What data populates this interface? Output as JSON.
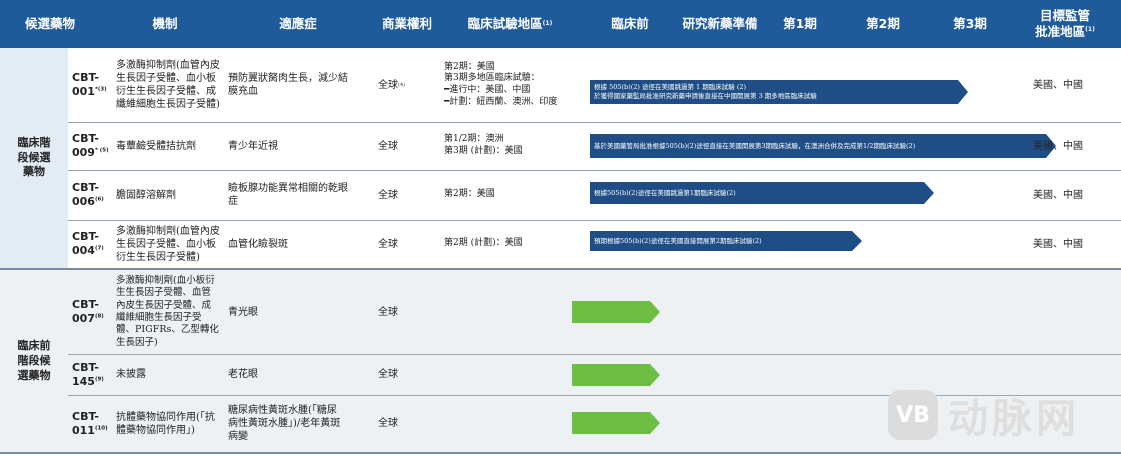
{
  "header": {
    "candidate": "候選藥物",
    "mechanism": "機制",
    "indication": "適應症",
    "rights": "商業權利",
    "region": "臨床試驗地區",
    "region_note": "(1)",
    "preclinical": "臨床前",
    "ind": "研究新藥準備",
    "phase1": "第1期",
    "phase2": "第2期",
    "phase3": "第3期",
    "target": "目標監管批准地區",
    "target_note": "(1)"
  },
  "categories": {
    "clinical": "臨床階段候選藥物",
    "preclinical": "臨床前階段候選藥物"
  },
  "rows": [
    {
      "code": "CBT-001",
      "note": "*(3)",
      "mechanism": "多激酶抑制劑(血管內皮生長因子受體、血小板衍生生長因子受體、成纖維細胞生長因子受體)",
      "indication": "預防翼狀胬肉生長，減少結膜充血",
      "rights": "全球",
      "rights_note": "(4)",
      "region": "第2期：美國\n第3期多地區臨床試驗：\n━進行中：美國、中國\n━計劃：紐西蘭、澳洲、印度",
      "arrow": "根據 505(b)(2) 途徑在美國跳過第 1 期臨床試驗 (2)\n於獲得國家藥監局批准研究新藥申請後直接在中國開展第 3 期多地區臨床試驗",
      "target": "美國、中國"
    },
    {
      "code": "CBT-009",
      "note": "* (5)",
      "mechanism": "毒蕈鹼受體拮抗劑",
      "indication": "青少年近視",
      "rights": "全球",
      "rights_note": "",
      "region": "第1/2期：澳洲\n第3期 (計劃)：美國",
      "arrow": "基於美國藥管局批准根據505(b)(2)途徑直接在美國開展第3期臨床試驗，在澳洲合併及完成第1/2期臨床試驗(2)",
      "target": "美國、中國"
    },
    {
      "code": "CBT-006",
      "note": "(6)",
      "mechanism": "膽固醇溶解劑",
      "indication": "瞼板腺功能異常相關的乾眼症",
      "rights": "全球",
      "rights_note": "",
      "region": "第2期：美國",
      "arrow": "根據505(b)(2)途徑在美國跳過第1期臨床試驗(2)",
      "target": "美國、中國"
    },
    {
      "code": "CBT-004",
      "note": "(7)",
      "mechanism": "多激酶抑制劑(血管內皮生長因子受體、血小板衍生生長因子受體)",
      "indication": "血管化瞼裂斑",
      "rights": "全球",
      "rights_note": "",
      "region": "第2期 (計劃)：美國",
      "arrow": "預期根據505(b)(2)途徑在美國直接開展第2期臨床試驗(2)",
      "target": "美國、中國"
    },
    {
      "code": "CBT-007",
      "note": "(8)",
      "mechanism": "多激酶抑制劑(血小板衍生生長因子受體、血管內皮生長因子受體、成纖維細胞生長因子受體、PIGFRs、乙型轉化生長因子)",
      "indication": "青光眼",
      "rights": "全球",
      "rights_note": "",
      "region": "",
      "arrow": "",
      "target": ""
    },
    {
      "code": "CBT-145",
      "note": "(9)",
      "mechanism": "未披露",
      "indication": "老花眼",
      "rights": "全球",
      "rights_note": "",
      "region": "",
      "arrow": "",
      "target": ""
    },
    {
      "code": "CBT-011",
      "note": "(10)",
      "mechanism": "抗體藥物協同作用(「抗體藥物協同作用」)",
      "indication": "糖尿病性黃斑水腫(「糖尿病性黃斑水腫」)/老年黃斑病變",
      "rights": "全球",
      "rights_note": "",
      "region": "",
      "arrow": "",
      "target": ""
    }
  ],
  "progress": [
    {
      "code": "CBT-001",
      "stage": "第3期",
      "fraction": 0.71
    },
    {
      "code": "CBT-009",
      "stage": "第3期",
      "fraction": 0.9
    },
    {
      "code": "CBT-006",
      "stage": "第2期",
      "fraction": 0.69
    },
    {
      "code": "CBT-004",
      "stage": "第2期",
      "fraction": 0.51
    },
    {
      "code": "CBT-007",
      "stage": "臨床前",
      "fraction": 0.17
    },
    {
      "code": "CBT-145",
      "stage": "臨床前",
      "fraction": 0.17
    },
    {
      "code": "CBT-011",
      "stage": "臨床前",
      "fraction": 0.17
    }
  ],
  "colors": {
    "header": "#1f5a9a",
    "clinical_arrow": "#1f4e86",
    "preclinical_arrow": "#6fbe44"
  },
  "watermark": "动脉网"
}
